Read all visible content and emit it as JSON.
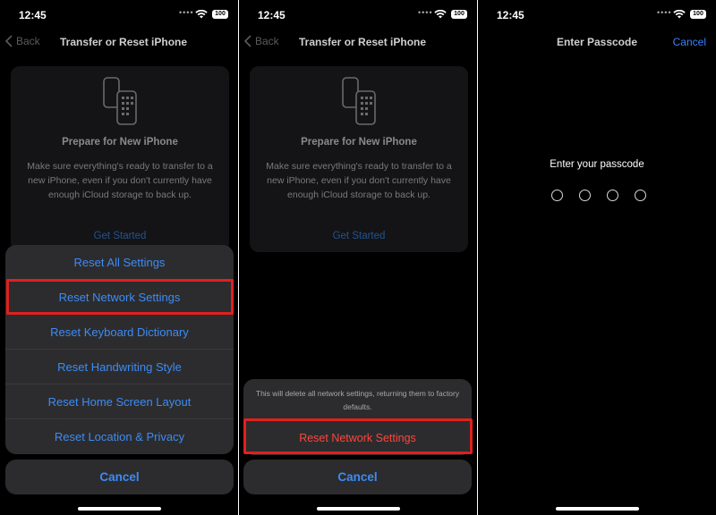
{
  "screens": [
    {
      "status": {
        "time": "12:45",
        "battery": "100"
      },
      "nav": {
        "back": "Back",
        "title": "Transfer or Reset iPhone"
      },
      "card": {
        "title": "Prepare for New iPhone",
        "description": "Make sure everything's ready to transfer to a new iPhone, even if you don't currently have enough iCloud storage to back up.",
        "action": "Get Started"
      },
      "sheet": {
        "options": [
          "Reset All Settings",
          "Reset Network Settings",
          "Reset Keyboard Dictionary",
          "Reset Handwriting Style",
          "Reset Home Screen Layout",
          "Reset Location & Privacy"
        ],
        "cancel": "Cancel"
      }
    },
    {
      "status": {
        "time": "12:45",
        "battery": "100"
      },
      "nav": {
        "back": "Back",
        "title": "Transfer or Reset iPhone"
      },
      "card": {
        "title": "Prepare for New iPhone",
        "description": "Make sure everything's ready to transfer to a new iPhone, even if you don't currently have enough iCloud storage to back up.",
        "action": "Get Started"
      },
      "confirm": {
        "message": "This will delete all network settings, returning them to factory defaults.",
        "destructive": "Reset Network Settings",
        "cancel": "Cancel"
      }
    },
    {
      "status": {
        "time": "12:45",
        "battery": "100"
      },
      "nav": {
        "title": "Enter Passcode",
        "cancel": "Cancel"
      },
      "prompt": "Enter your passcode",
      "passcode_length": 4
    }
  ],
  "colors": {
    "accent": "#3d8bf5",
    "destructive": "#ff453a",
    "highlight": "#e0201f"
  }
}
